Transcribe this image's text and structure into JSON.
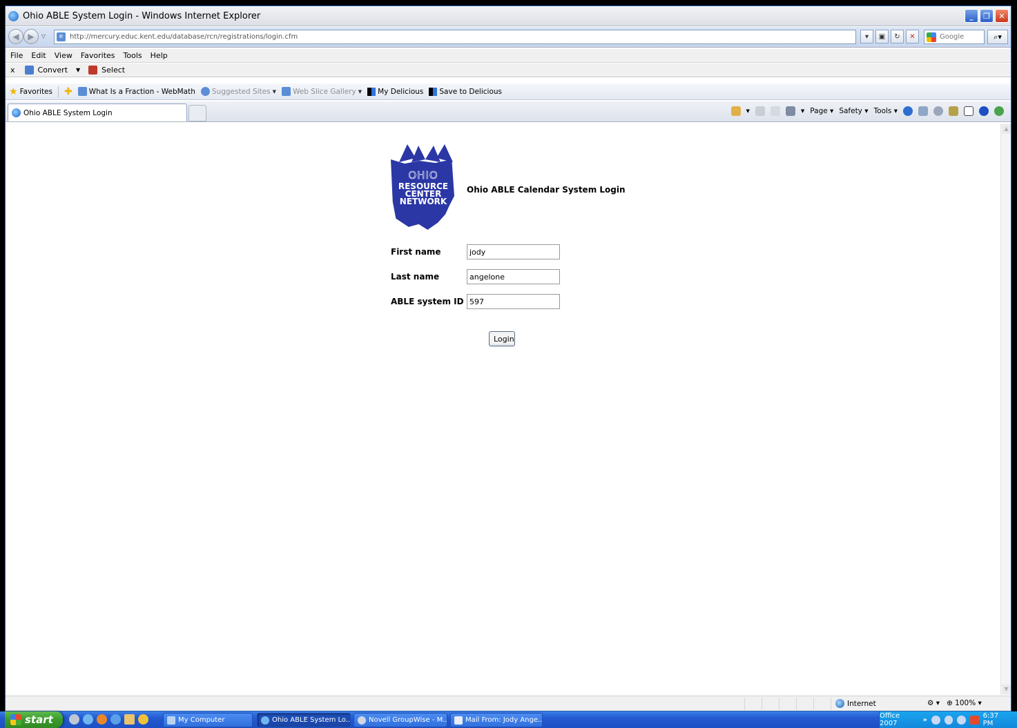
{
  "window": {
    "title": "Ohio ABLE System Login - Windows Internet Explorer",
    "controls": {
      "minimize": "_",
      "restore": "❐",
      "close": "✕"
    }
  },
  "addressbar": {
    "url": "http://mercury.educ.kent.edu/database/rcn/registrations/login.cfm",
    "search_placeholder": "Google"
  },
  "menubar": {
    "items": [
      "File",
      "Edit",
      "View",
      "Favorites",
      "Tools",
      "Help"
    ]
  },
  "convertbar": {
    "close": "x",
    "convert": "Convert",
    "select": "Select"
  },
  "favorites": {
    "label": "Favorites",
    "items": [
      {
        "label": "What Is a Fraction - WebMath"
      },
      {
        "label": "Suggested Sites"
      },
      {
        "label": "Web Slice Gallery"
      },
      {
        "label": "My Delicious"
      },
      {
        "label": "Save to Delicious"
      }
    ]
  },
  "tabs": {
    "active": "Ohio ABLE System Login"
  },
  "commandbar": {
    "page": "Page",
    "safety": "Safety",
    "tools": "Tools"
  },
  "page": {
    "logo": {
      "ohio": "OHIO",
      "line1": "RESOURCE",
      "line2": "CENTER",
      "line3": "NETWORK"
    },
    "title": "Ohio ABLE Calendar System Login",
    "first_name_label": "First name",
    "first_name_value": "jody",
    "last_name_label": "Last name",
    "last_name_value": "angelone",
    "system_id_label": "ABLE system ID",
    "system_id_value": "597",
    "login_button": "Login"
  },
  "statusbar": {
    "zone": "Internet",
    "zoom": "100%"
  },
  "taskbar": {
    "start": "start",
    "tasks": [
      {
        "label": "My Computer"
      },
      {
        "label": "Ohio ABLE System Lo..."
      },
      {
        "label": "Novell GroupWise - M..."
      },
      {
        "label": "Mail From: Jody Ange..."
      }
    ],
    "tray_label": "Office 2007",
    "clock": "6:37 PM"
  },
  "colors": {
    "logo_blue": "#2b37a5",
    "taskbar_blue": "#2459d1",
    "start_green": "#3a9a2c"
  }
}
